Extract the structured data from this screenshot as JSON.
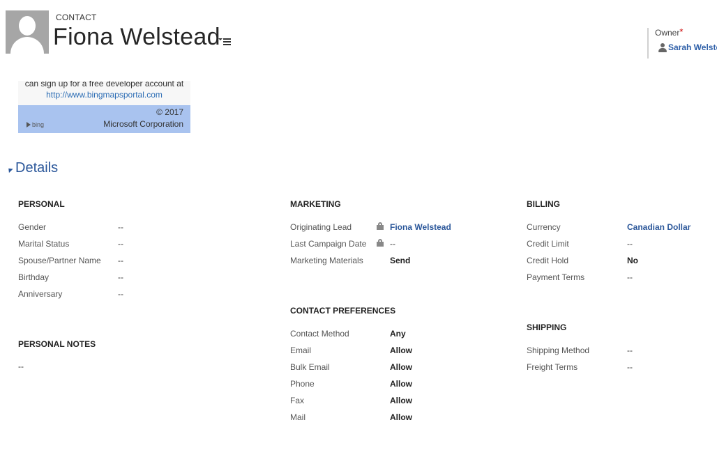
{
  "header": {
    "entity_type": "CONTACT",
    "record_name": "Fiona Welstead",
    "owner_label": "Owner",
    "owner_required_marker": "*",
    "owner_value": "Sarah Welstead"
  },
  "map": {
    "line1": "can sign up for a free developer account at",
    "link": "http://www.bingmapsportal.com",
    "copyright": "© 2017",
    "corporation": "Microsoft Corporation",
    "logo_text": "bing"
  },
  "section": {
    "title": "Details"
  },
  "personal": {
    "title": "PERSONAL",
    "fields": [
      {
        "label": "Gender",
        "value": "--"
      },
      {
        "label": "Marital Status",
        "value": "--"
      },
      {
        "label": "Spouse/Partner Name",
        "value": "--"
      },
      {
        "label": "Birthday",
        "value": "--"
      },
      {
        "label": "Anniversary",
        "value": "--"
      }
    ]
  },
  "personal_notes": {
    "title": "PERSONAL NOTES",
    "value": "--"
  },
  "marketing": {
    "title": "MARKETING",
    "fields": [
      {
        "label": "Originating Lead",
        "value": "Fiona Welstead"
      },
      {
        "label": "Last Campaign Date",
        "value": "--"
      },
      {
        "label": "Marketing Materials",
        "value": "Send"
      }
    ]
  },
  "contact_preferences": {
    "title": "CONTACT PREFERENCES",
    "fields": [
      {
        "label": "Contact Method",
        "value": "Any"
      },
      {
        "label": "Email",
        "value": "Allow"
      },
      {
        "label": "Bulk Email",
        "value": "Allow"
      },
      {
        "label": "Phone",
        "value": "Allow"
      },
      {
        "label": "Fax",
        "value": "Allow"
      },
      {
        "label": "Mail",
        "value": "Allow"
      }
    ]
  },
  "billing": {
    "title": "BILLING",
    "fields": [
      {
        "label": "Currency",
        "value": "Canadian Dollar"
      },
      {
        "label": "Credit Limit",
        "value": "--"
      },
      {
        "label": "Credit Hold",
        "value": "No"
      },
      {
        "label": "Payment Terms",
        "value": "--"
      }
    ]
  },
  "shipping": {
    "title": "SHIPPING",
    "fields": [
      {
        "label": "Shipping Method",
        "value": "--"
      },
      {
        "label": "Freight Terms",
        "value": "--"
      }
    ]
  }
}
